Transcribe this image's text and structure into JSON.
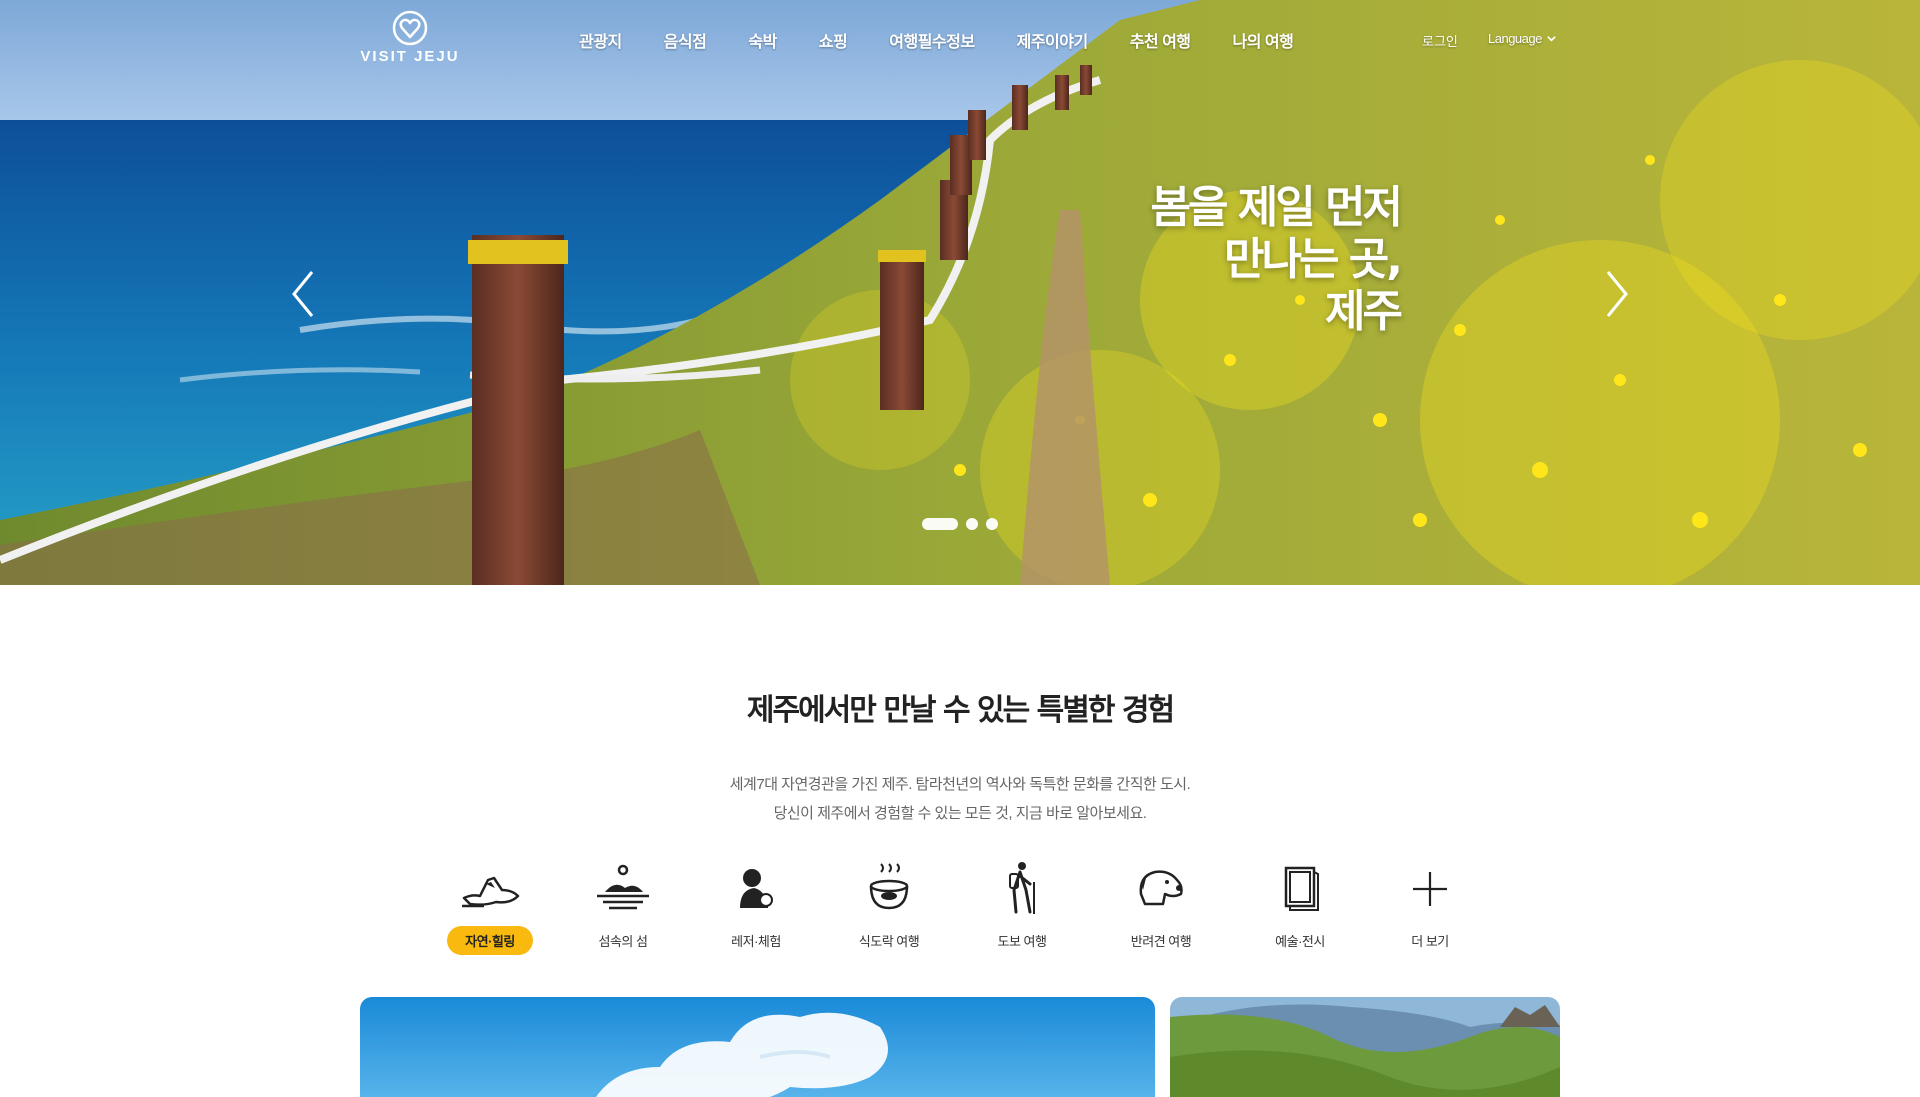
{
  "brand": {
    "name": "VISIT JEJU",
    "accent": "#f9b90e"
  },
  "nav": {
    "menu": [
      "관광지",
      "음식점",
      "숙박",
      "쇼핑",
      "여행필수정보",
      "제주이야기",
      "추천 여행",
      "나의 여행"
    ],
    "login": "로그인",
    "language": "Language"
  },
  "hero": {
    "headline": [
      "봄을 제일 먼저",
      "만나는 곳,",
      "제주"
    ],
    "slide_count": 3,
    "active_slide": 1
  },
  "intro": {
    "title": "제주에서만 만날 수 있는 특별한 경험",
    "desc": [
      "세계7대 자연경관을 가진 제주. 탐라천년의 역사와 독특한 문화를 간직한 도시.",
      "당신이 제주에서 경험할 수 있는 모든 것, 지금 바로 알아보세요."
    ]
  },
  "categories": [
    {
      "label": "자연·힐링",
      "icon": "mountain-icon",
      "active": true
    },
    {
      "label": "섬속의 섬",
      "icon": "island-icon",
      "active": false
    },
    {
      "label": "레저·체험",
      "icon": "leisure-icon",
      "active": false
    },
    {
      "label": "식도락 여행",
      "icon": "food-bowl-icon",
      "active": false
    },
    {
      "label": "도보 여행",
      "icon": "hiker-icon",
      "active": false
    },
    {
      "label": "반려견 여행",
      "icon": "dog-icon",
      "active": false
    },
    {
      "label": "예술·전시",
      "icon": "frame-icon",
      "active": false
    },
    {
      "label": "더 보기",
      "icon": "plus-icon",
      "active": false
    }
  ]
}
